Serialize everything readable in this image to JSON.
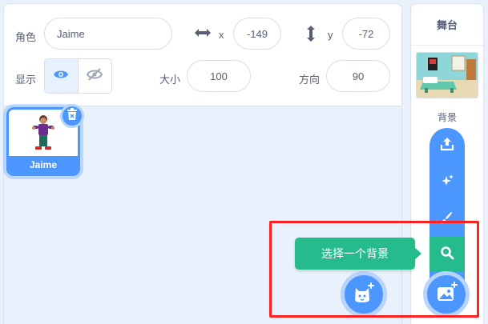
{
  "sprite_info": {
    "sprite_label": "角色",
    "sprite_name": "Jaime",
    "x_label": "x",
    "x_value": "-149",
    "y_label": "y",
    "y_value": "-72",
    "show_label": "显示",
    "size_label": "大小",
    "size_value": "100",
    "direction_label": "方向",
    "direction_value": "90"
  },
  "sprites": [
    {
      "name": "Jaime",
      "selected": true
    }
  ],
  "stage": {
    "title": "舞台",
    "backdrops_label": "背景"
  },
  "backdrop_menu": {
    "items": [
      "upload-icon",
      "surprise-icon",
      "paint-icon",
      "search-icon"
    ],
    "active_item": "search-icon",
    "tooltip": "选择一个背景"
  },
  "colors": {
    "accent": "#4c97ff",
    "active": "#26bb8d",
    "highlight": "#ff2020"
  }
}
